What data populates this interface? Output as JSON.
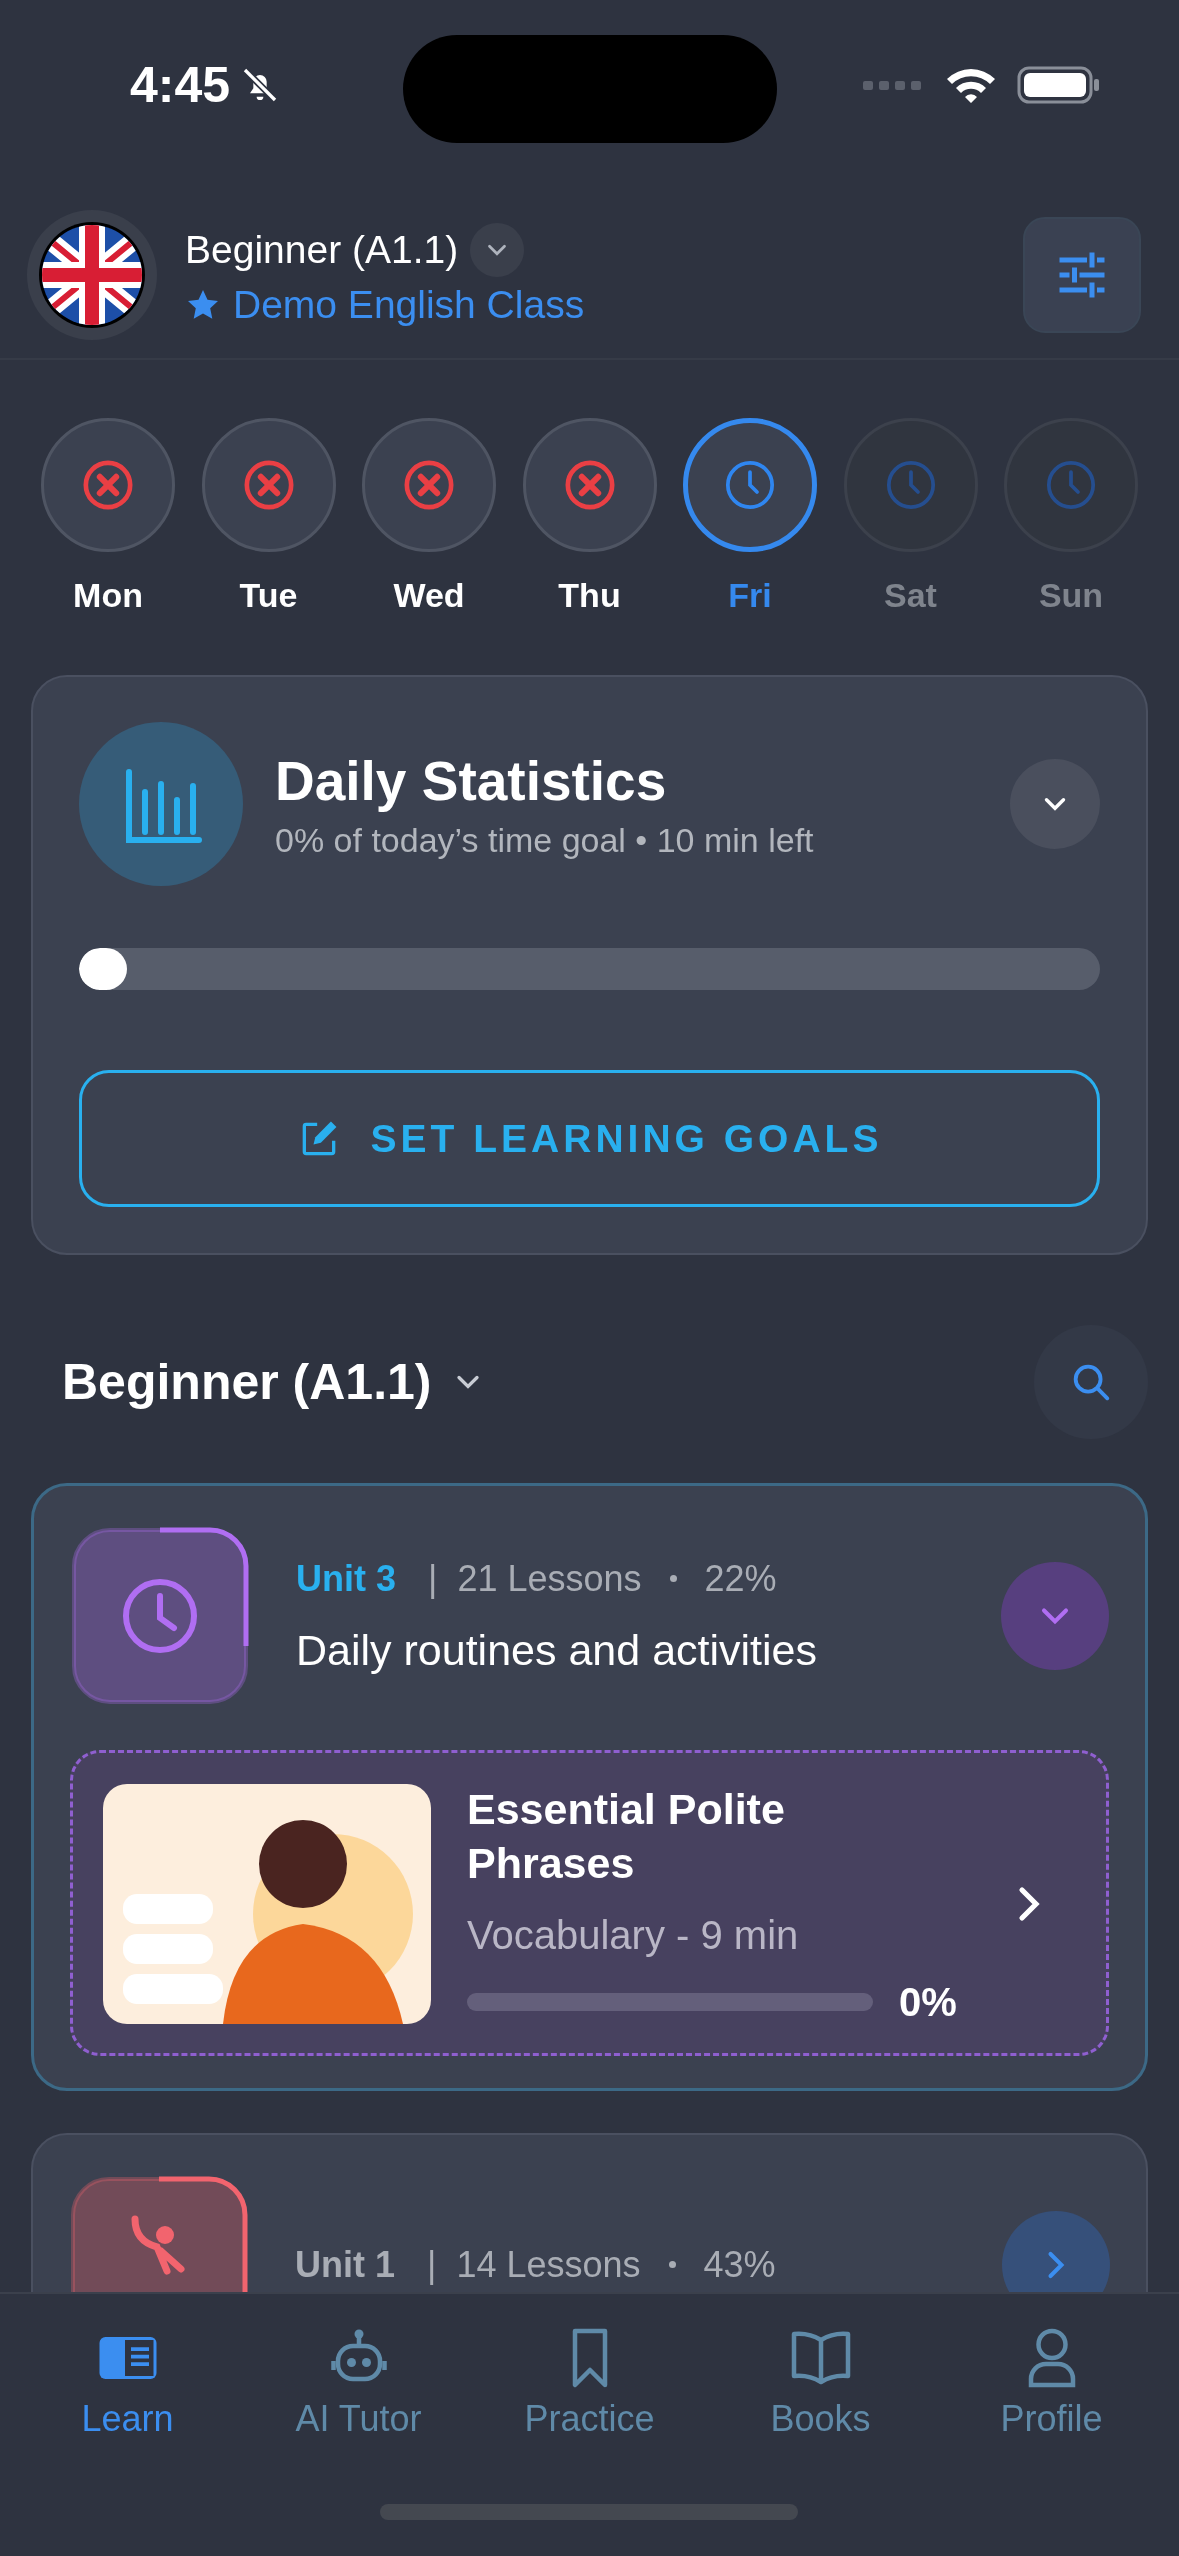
{
  "status_bar": {
    "time": "4:45"
  },
  "header": {
    "level": "Beginner (A1.1)",
    "class_name": "Demo English Class"
  },
  "days": [
    {
      "label": "Mon",
      "kind": "missed",
      "selected": false
    },
    {
      "label": "Tue",
      "kind": "missed",
      "selected": false
    },
    {
      "label": "Wed",
      "kind": "missed",
      "selected": false
    },
    {
      "label": "Thu",
      "kind": "missed",
      "selected": false
    },
    {
      "label": "Fri",
      "kind": "pending",
      "selected": true
    },
    {
      "label": "Sat",
      "kind": "upcoming",
      "selected": false
    },
    {
      "label": "Sun",
      "kind": "upcoming",
      "selected": false
    }
  ],
  "daily_statistics": {
    "title": "Daily Statistics",
    "subtitle": "0% of today’s time goal • 10 min left",
    "level": 0,
    "button": "SET LEARNING GOALS"
  },
  "course": {
    "title": "Beginner (A1.1)"
  },
  "units": [
    {
      "unit": "Unit 3",
      "separator": "|",
      "lessons": "21 Lessons",
      "percent": "22%",
      "title": "Daily routines and activities",
      "kind": "clock",
      "color": "#b06ef2",
      "expanded": true,
      "lesson_items": [
        {
          "title": "Essential Polite Phrases",
          "meta": "Vocabulary - 9 min",
          "level": 0,
          "percent": "0%"
        }
      ]
    },
    {
      "unit": "Unit 1",
      "separator": "|",
      "lessons": "14 Lessons",
      "percent": "43%",
      "kind": "wave",
      "color": "#f2646e",
      "expanded": false
    }
  ],
  "tabs": [
    {
      "label": "Learn",
      "kind": "book",
      "selected": true
    },
    {
      "label": "AI Tutor",
      "kind": "robot",
      "selected": false
    },
    {
      "label": "Practice",
      "kind": "bookmark",
      "selected": false
    },
    {
      "label": "Books",
      "kind": "open-book",
      "selected": false
    },
    {
      "label": "Profile",
      "kind": "person",
      "selected": false
    }
  ]
}
